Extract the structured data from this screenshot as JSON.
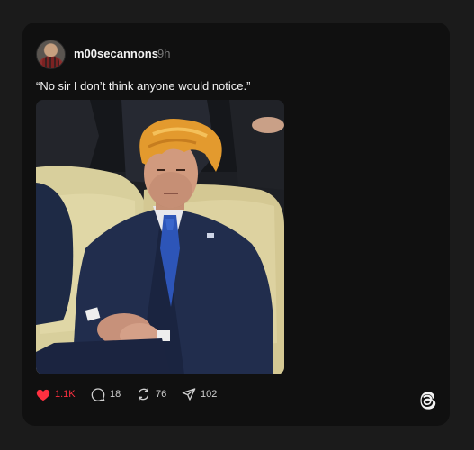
{
  "post": {
    "username": "m00secannons",
    "timestamp": "9h",
    "text": "“No sir I don’t think anyone would notice.”",
    "image_alt": "Man in a navy suit and blue tie wearing an orange wig, seated on a cream armchair"
  },
  "actions": {
    "like_count": "1.1K",
    "reply_count": "18",
    "repost_count": "76",
    "share_count": "102"
  },
  "icons": {
    "like": "heart-icon",
    "reply": "comment-icon",
    "repost": "repost-icon",
    "share": "send-icon",
    "brand": "threads-logo-icon"
  },
  "colors": {
    "background": "#1b1b1b",
    "card": "#101010",
    "text": "#f3f3f3",
    "muted": "#7a7a7a",
    "like": "#ff3040"
  }
}
